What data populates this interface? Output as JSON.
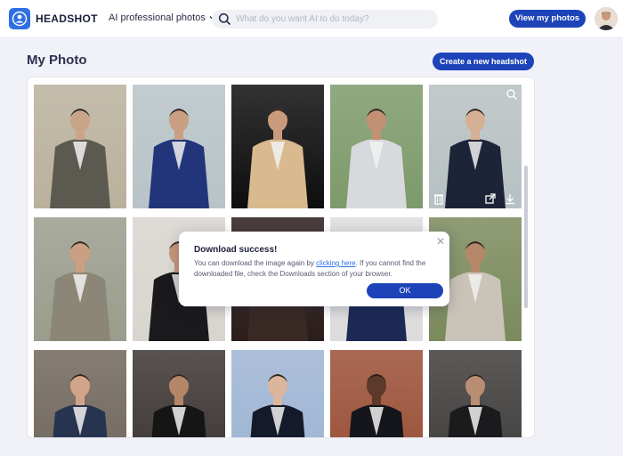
{
  "header": {
    "logo_text": "HEADSHOT",
    "nav_dropdown_label": "AI professional photos",
    "search_placeholder": "What do you want AI to do today?",
    "view_button_label": "View my photos"
  },
  "main": {
    "title": "My Photo",
    "create_button_label": "Create a new headshot"
  },
  "photos": [
    {
      "bg": "#b9b19c",
      "suit": "#5c5a50",
      "skin": "#caa488"
    },
    {
      "bg": "#b7c3c7",
      "suit": "#22347a",
      "skin": "#c9a083"
    },
    {
      "bg": "#0e0e0e",
      "suit": "#d9b98e",
      "skin": "#c99a7c"
    },
    {
      "bg": "#7d9a6a",
      "suit": "#d8d9dd",
      "skin": "#c29173"
    },
    {
      "bg": "#b7c0c2",
      "suit": "#1e2438",
      "skin": "#d6b095"
    },
    {
      "bg": "#9a9c8c",
      "suit": "#8b8676",
      "skin": "#cc9f82"
    },
    {
      "bg": "#d8d4ce",
      "suit": "#1a1a1d",
      "skin": "#c5977a"
    },
    {
      "bg": "#2a1d1a",
      "suit": "#3a2a25",
      "skin": "#b98a6e"
    },
    {
      "bg": "#dcdcdc",
      "suit": "#1d2a55",
      "skin": "#c99a7c"
    },
    {
      "bg": "#7b8a5d",
      "suit": "#c9c3b8",
      "skin": "#b58868"
    },
    {
      "bg": "#70665c",
      "suit": "#263450",
      "skin": "#d2a48a"
    },
    {
      "bg": "#3b3533",
      "suit": "#151515",
      "skin": "#b58567"
    },
    {
      "bg": "#9db4d3",
      "suit": "#151a2b",
      "skin": "#dbb59c"
    },
    {
      "bg": "#9a4f36",
      "suit": "#14161c",
      "skin": "#5b3a29"
    },
    {
      "bg": "#3f3d3b",
      "suit": "#1b1b1d",
      "skin": "#b88d72"
    }
  ],
  "dialog": {
    "title": "Download success!",
    "text_before_link": "You can download the image again by ",
    "link_text": "clicking here",
    "text_after_link": ". If you cannot find the downloaded file, check the Downloads section of your browser.",
    "ok_label": "OK"
  },
  "colors": {
    "accent": "#1d43b8",
    "logo": "#2f6fe4"
  }
}
